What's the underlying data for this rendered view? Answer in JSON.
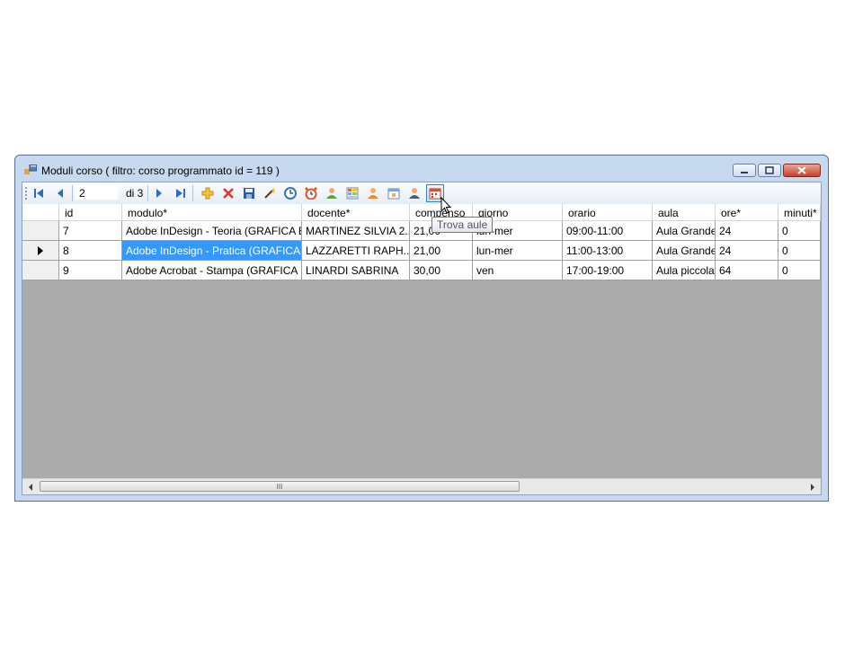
{
  "window": {
    "title": "Moduli corso ( filtro: corso programmato id = 119 )"
  },
  "toolbar": {
    "position": "2",
    "count_label": "di 3",
    "buttons": [
      {
        "name": "move-first-button",
        "icon": "first-icon"
      },
      {
        "name": "move-previous-button",
        "icon": "previous-icon"
      },
      {
        "name": "move-next-button",
        "icon": "next-icon"
      },
      {
        "name": "move-last-button",
        "icon": "last-icon"
      },
      {
        "name": "add-new-button",
        "icon": "plus-icon"
      },
      {
        "name": "delete-button",
        "icon": "delete-icon"
      },
      {
        "name": "save-button",
        "icon": "floppy-disk-icon"
      },
      {
        "name": "wizard-button",
        "icon": "magic-wand-icon"
      },
      {
        "name": "clock-button",
        "icon": "clock-icon"
      },
      {
        "name": "alarm-button",
        "icon": "alarm-clock-icon"
      },
      {
        "name": "user-button",
        "icon": "user-icon"
      },
      {
        "name": "grid-button",
        "icon": "grid-icon"
      },
      {
        "name": "person-button",
        "icon": "person-icon"
      },
      {
        "name": "calendar-button",
        "icon": "calendar-icon"
      },
      {
        "name": "teacher-button",
        "icon": "teacher-icon"
      },
      {
        "name": "find-rooms-button",
        "icon": "calendar-find-icon"
      }
    ]
  },
  "tooltip": "Trova aule",
  "grid": {
    "columns": [
      "id",
      "modulo*",
      "docente*",
      "compenso",
      "giorno",
      "orario",
      "aula",
      "ore*",
      "minuti*"
    ],
    "current_row": 1,
    "selected_cell": {
      "row": 1,
      "col": 1
    },
    "rows": [
      [
        "7",
        "Adobe InDesign - Teoria (GRAFICA E...",
        "MARTINEZ SILVIA 2...",
        "21,00",
        "lun-mer",
        "09:00-11:00",
        "Aula Grande",
        "24",
        "0"
      ],
      [
        "8",
        "Adobe InDesign - Pratica (GRAFICA E...",
        "LAZZARETTI RAPH...",
        "21,00",
        "lun-mer",
        "11:00-13:00",
        "Aula Grande",
        "24",
        "0"
      ],
      [
        "9",
        "Adobe Acrobat - Stampa (GRAFICA E...",
        "LINARDI SABRINA",
        "30,00",
        "ven",
        "17:00-19:00",
        "Aula piccola",
        "64",
        "0"
      ]
    ]
  },
  "scrollbar": {
    "grip_label": "III"
  },
  "colors": {
    "selection": "#3399ff",
    "grid_background": "#ababab"
  }
}
